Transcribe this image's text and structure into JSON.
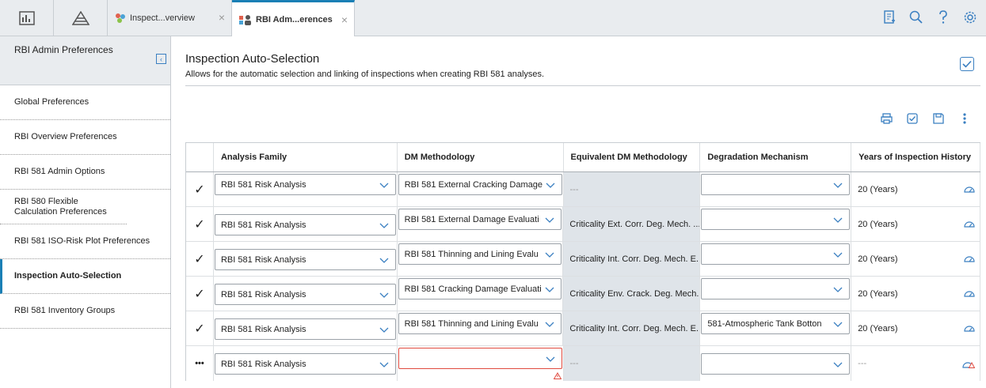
{
  "topbar": {
    "tabs": [
      {
        "label": "Inspect...verview",
        "active": false
      },
      {
        "label": "RBI Adm...erences",
        "active": true
      }
    ],
    "close_glyph": "×"
  },
  "sidebar": {
    "title": "RBI Admin Preferences",
    "collapse_glyph": "‹",
    "items": [
      {
        "label": "Global Preferences",
        "active": false
      },
      {
        "label": "RBI Overview Preferences",
        "active": false
      },
      {
        "label": "RBI 581 Admin Options",
        "active": false
      },
      {
        "label": "RBI 580 Flexible Calculation Preferences",
        "active": false
      },
      {
        "label": "RBI 581 ISO-Risk Plot Preferences",
        "active": false
      },
      {
        "label": "Inspection Auto-Selection",
        "active": true
      },
      {
        "label": "RBI 581 Inventory Groups",
        "active": false
      }
    ]
  },
  "main": {
    "title": "Inspection Auto-Selection",
    "description": "Allows for the automatic selection and linking of inspections when creating RBI 581 analyses."
  },
  "grid": {
    "headers": [
      "Analysis Family",
      "DM Methodology",
      "Equivalent DM Methodology",
      "Degradation Mechanism",
      "Years of Inspection History"
    ],
    "rows": [
      {
        "status": "✓",
        "family": "RBI 581 Risk Analysis",
        "dm": "RBI 581 External Cracking Damage",
        "equiv": "---",
        "mech": "",
        "years": "20 (Years)"
      },
      {
        "status": "✓",
        "family": "RBI 581 Risk Analysis",
        "dm": "RBI 581 External Damage Evaluati",
        "equiv": "Criticality Ext. Corr. Deg. Mech. ...",
        "mech": "",
        "years": "20 (Years)"
      },
      {
        "status": "✓",
        "family": "RBI 581 Risk Analysis",
        "dm": "RBI 581 Thinning and Lining Evalu",
        "equiv": "Criticality Int. Corr. Deg. Mech. E...",
        "mech": "",
        "years": "20 (Years)"
      },
      {
        "status": "✓",
        "family": "RBI 581 Risk Analysis",
        "dm": "RBI 581 Cracking Damage Evaluati",
        "equiv": "Criticality Env. Crack. Deg. Mech...",
        "mech": "",
        "years": "20 (Years)"
      },
      {
        "status": "✓",
        "family": "RBI 581 Risk Analysis",
        "dm": "RBI 581 Thinning and Lining Evalu",
        "equiv": "Criticality Int. Corr. Deg. Mech. E...",
        "mech": "581-Atmospheric Tank Botton",
        "years": "20 (Years)"
      },
      {
        "status": "•••",
        "family": "RBI 581 Risk Analysis",
        "dm": "",
        "equiv": "---",
        "mech": "",
        "years": "---"
      }
    ]
  },
  "colors": {
    "accent": "#1a7fb5",
    "icon_blue": "#3a7fc1",
    "error": "#e04a3f",
    "readonly_bg": "#dfe4e9"
  }
}
